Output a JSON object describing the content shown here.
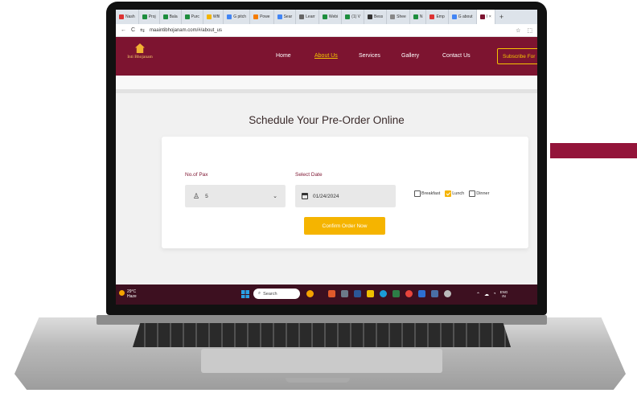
{
  "browser": {
    "tabs": [
      {
        "label": "Nash",
        "color": "#d33"
      },
      {
        "label": "Proj",
        "color": "#1e8e3e"
      },
      {
        "label": "Bala",
        "color": "#1e8e3e"
      },
      {
        "label": "Purc",
        "color": "#1e8e3e"
      },
      {
        "label": "Wfil",
        "color": "#f4b400"
      },
      {
        "label": "G pitch",
        "color": "#4285f4"
      },
      {
        "label": "Powe",
        "color": "#f57c00"
      },
      {
        "label": "Sear",
        "color": "#4285f4"
      },
      {
        "label": "Learr",
        "color": "#666"
      },
      {
        "label": "Webi",
        "color": "#1e8e3e"
      },
      {
        "label": "(1) V",
        "color": "#1e8e3e"
      },
      {
        "label": "Bess",
        "color": "#333"
      },
      {
        "label": "Shee",
        "color": "#888"
      },
      {
        "label": "N",
        "color": "#1e8e3e"
      },
      {
        "label": "Emp",
        "color": "#d33"
      },
      {
        "label": "G about",
        "color": "#4285f4"
      },
      {
        "label": "I",
        "color": "#7d1430"
      }
    ],
    "new_tab": "+",
    "close": "×",
    "back": "←",
    "reload": "C",
    "url": "maaintibhojanam.com/#/about_us"
  },
  "site": {
    "logo_text": "Inti Bhojanam",
    "nav": [
      "Home",
      "About Us",
      "Services",
      "Gallery",
      "Contact Us"
    ],
    "subscribe": "Subscribe For",
    "heading": "Schedule Your Pre-Order Online",
    "form": {
      "pax_label": "No.of Pax",
      "pax_value": "5",
      "date_label": "Select Date",
      "date_value": "01/24/2024",
      "meals": [
        {
          "label": "Breakfast",
          "checked": false
        },
        {
          "label": "Lunch",
          "checked": true
        },
        {
          "label": "Dinner",
          "checked": false
        }
      ],
      "confirm": "Confirm Order Now"
    }
  },
  "taskbar": {
    "weather_temp": "29°C",
    "weather_desc": "Haze",
    "search": "Search",
    "lang_top": "ENG",
    "lang_bottom": "IN"
  },
  "colors": {
    "brand": "#7d1430",
    "accent": "#f5b400"
  }
}
